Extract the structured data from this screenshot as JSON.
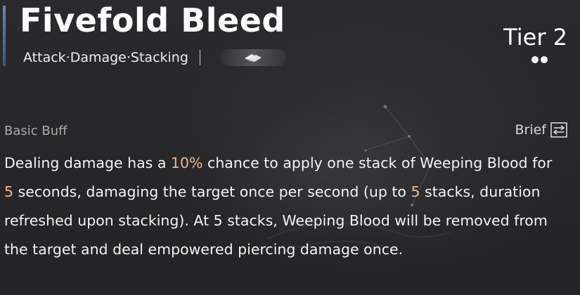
{
  "skill": {
    "title": "Fivefold Bleed",
    "tags": "Attack·Damage·Stacking",
    "tier_label": "Tier 2",
    "tier_level": 2,
    "badge_icon": "cards-icon"
  },
  "section": {
    "label": "Basic Buff",
    "toggle_label": "Brief",
    "toggle_icon": "swap-arrows-icon"
  },
  "description": {
    "part1": "Dealing damage has a ",
    "chance": "10%",
    "part2": " chance to apply one stack of Weeping Blood for ",
    "duration": "5",
    "part3": " seconds, damaging the target once per second (up to ",
    "max_stacks": "5",
    "part4": " stacks, duration refreshed upon stacking). At 5 stacks, Weeping Blood will be removed from the target and deal empowered piercing damage once."
  },
  "colors": {
    "highlight": "#f0b58c",
    "accent_bar": "#4a6a96",
    "background": "#28282b"
  }
}
